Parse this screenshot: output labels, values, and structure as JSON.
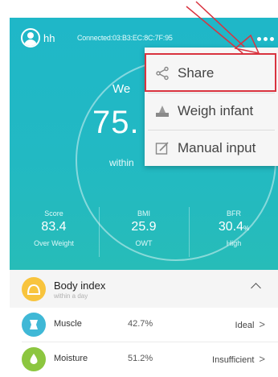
{
  "header": {
    "username": "hh",
    "connection_status": "Connected:03:B3:EC:8C:7F:95",
    "weight_label": "We",
    "weight_value": "75.",
    "weight_sub": "within"
  },
  "menu": {
    "items": [
      {
        "label": "Share",
        "icon": "share-icon"
      },
      {
        "label": "Weigh infant",
        "icon": "scale-icon"
      },
      {
        "label": "Manual input",
        "icon": "edit-icon"
      }
    ]
  },
  "metrics": [
    {
      "label": "Score",
      "value": "83.4",
      "unit": "",
      "status": "Over Weight"
    },
    {
      "label": "BMI",
      "value": "25.9",
      "unit": "",
      "status": "OWT"
    },
    {
      "label": "BFR",
      "value": "30.4",
      "unit": "%",
      "status": "High"
    }
  ],
  "body_index": {
    "title": "Body index",
    "subtitle": "within a day",
    "rows": [
      {
        "name": "Muscle",
        "value": "42.7%",
        "status": "Ideal",
        "color": "#3fb8d6",
        "icon": "muscle-icon"
      },
      {
        "name": "Moisture",
        "value": "51.2%",
        "status": "Insufficient",
        "color": "#8cc63f",
        "icon": "water-drop-icon"
      }
    ]
  },
  "colors": {
    "header_bg": "#22b9c3",
    "highlight": "#d9333f",
    "body_index_icon": "#f8c43d"
  }
}
